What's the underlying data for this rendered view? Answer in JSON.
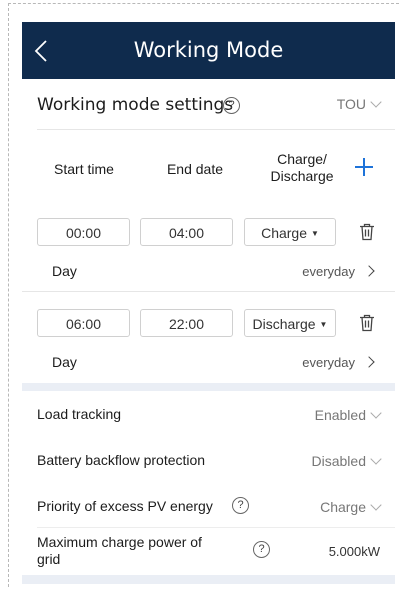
{
  "header": {
    "title": "Working Mode"
  },
  "settings": {
    "label": "Working mode settings",
    "help": "?",
    "mode_value": "TOU"
  },
  "columns": {
    "start": "Start time",
    "end": "End date",
    "charge_line1": "Charge/",
    "charge_line2": "Discharge"
  },
  "schedules": [
    {
      "start": "00:00",
      "end": "04:00",
      "type": "Charge",
      "day_label": "Day",
      "repeat": "everyday"
    },
    {
      "start": "06:00",
      "end": "22:00",
      "type": "Discharge",
      "day_label": "Day",
      "repeat": "everyday"
    }
  ],
  "load_tracking": {
    "label": "Load tracking",
    "value": "Enabled"
  },
  "battery_backflow": {
    "label": "Battery backflow protection",
    "value": "Disabled"
  },
  "excess_pv": {
    "label": "Priority of excess PV energy",
    "help": "?",
    "value": "Charge"
  },
  "max_charge": {
    "label_line1": "Maximum charge power of",
    "label_line2": "grid",
    "help": "?",
    "value": "5.000kW"
  },
  "colors": {
    "header_bg": "#0f2b4d",
    "accent": "#1e73d9",
    "band": "#eaeef5"
  }
}
